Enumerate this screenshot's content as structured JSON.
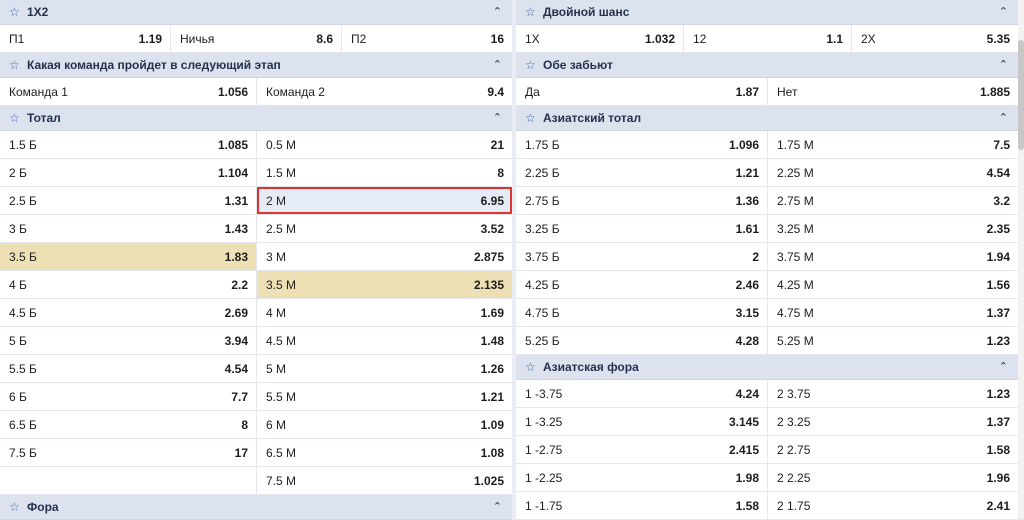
{
  "left": {
    "x12": {
      "title": "1X2",
      "items": [
        {
          "label": "П1",
          "odd": "1.19"
        },
        {
          "label": "Ничья",
          "odd": "8.6"
        },
        {
          "label": "П2",
          "odd": "16"
        }
      ]
    },
    "advance": {
      "title": "Какая команда пройдет в следующий этап",
      "items": [
        {
          "label": "Команда 1",
          "odd": "1.056"
        },
        {
          "label": "Команда 2",
          "odd": "9.4"
        }
      ]
    },
    "total": {
      "title": "Тотал",
      "rows": [
        [
          {
            "label": "1.5 Б",
            "odd": "1.085"
          },
          {
            "label": "0.5 М",
            "odd": "21"
          }
        ],
        [
          {
            "label": "2 Б",
            "odd": "1.104"
          },
          {
            "label": "1.5 М",
            "odd": "8"
          }
        ],
        [
          {
            "label": "2.5 Б",
            "odd": "1.31"
          },
          {
            "label": "2 М",
            "odd": "6.95",
            "selected": true
          }
        ],
        [
          {
            "label": "3 Б",
            "odd": "1.43"
          },
          {
            "label": "2.5 М",
            "odd": "3.52"
          }
        ],
        [
          {
            "label": "3.5 Б",
            "odd": "1.83",
            "highlight": true
          },
          {
            "label": "3 М",
            "odd": "2.875"
          }
        ],
        [
          {
            "label": "4 Б",
            "odd": "2.2"
          },
          {
            "label": "3.5 М",
            "odd": "2.135",
            "highlight": true
          }
        ],
        [
          {
            "label": "4.5 Б",
            "odd": "2.69"
          },
          {
            "label": "4 М",
            "odd": "1.69"
          }
        ],
        [
          {
            "label": "5 Б",
            "odd": "3.94"
          },
          {
            "label": "4.5 М",
            "odd": "1.48"
          }
        ],
        [
          {
            "label": "5.5 Б",
            "odd": "4.54"
          },
          {
            "label": "5 М",
            "odd": "1.26"
          }
        ],
        [
          {
            "label": "6 Б",
            "odd": "7.7"
          },
          {
            "label": "5.5 М",
            "odd": "1.21"
          }
        ],
        [
          {
            "label": "6.5 Б",
            "odd": "8"
          },
          {
            "label": "6 М",
            "odd": "1.09"
          }
        ],
        [
          {
            "label": "7.5 Б",
            "odd": "17"
          },
          {
            "label": "6.5 М",
            "odd": "1.08"
          }
        ],
        [
          {
            "label": "",
            "odd": ""
          },
          {
            "label": "7.5 М",
            "odd": "1.025"
          }
        ]
      ]
    },
    "fora": {
      "title": "Фора"
    }
  },
  "right": {
    "double": {
      "title": "Двойной шанс",
      "items": [
        {
          "label": "1X",
          "odd": "1.032"
        },
        {
          "label": "12",
          "odd": "1.1"
        },
        {
          "label": "2X",
          "odd": "5.35"
        }
      ]
    },
    "btts": {
      "title": "Обе забьют",
      "items": [
        {
          "label": "Да",
          "odd": "1.87"
        },
        {
          "label": "Нет",
          "odd": "1.885"
        }
      ]
    },
    "asianTotal": {
      "title": "Азиатский тотал",
      "rows": [
        [
          {
            "label": "1.75 Б",
            "odd": "1.096"
          },
          {
            "label": "1.75 М",
            "odd": "7.5"
          }
        ],
        [
          {
            "label": "2.25 Б",
            "odd": "1.21"
          },
          {
            "label": "2.25 М",
            "odd": "4.54"
          }
        ],
        [
          {
            "label": "2.75 Б",
            "odd": "1.36"
          },
          {
            "label": "2.75 М",
            "odd": "3.2"
          }
        ],
        [
          {
            "label": "3.25 Б",
            "odd": "1.61"
          },
          {
            "label": "3.25 М",
            "odd": "2.35"
          }
        ],
        [
          {
            "label": "3.75 Б",
            "odd": "2"
          },
          {
            "label": "3.75 М",
            "odd": "1.94"
          }
        ],
        [
          {
            "label": "4.25 Б",
            "odd": "2.46"
          },
          {
            "label": "4.25 М",
            "odd": "1.56"
          }
        ],
        [
          {
            "label": "4.75 Б",
            "odd": "3.15"
          },
          {
            "label": "4.75 М",
            "odd": "1.37"
          }
        ],
        [
          {
            "label": "5.25 Б",
            "odd": "4.28"
          },
          {
            "label": "5.25 М",
            "odd": "1.23"
          }
        ]
      ]
    },
    "asianFora": {
      "title": "Азиатская фора",
      "rows": [
        [
          {
            "label": "1 -3.75",
            "odd": "4.24"
          },
          {
            "label": "2 3.75",
            "odd": "1.23"
          }
        ],
        [
          {
            "label": "1 -3.25",
            "odd": "3.145"
          },
          {
            "label": "2 3.25",
            "odd": "1.37"
          }
        ],
        [
          {
            "label": "1 -2.75",
            "odd": "2.415"
          },
          {
            "label": "2 2.75",
            "odd": "1.58"
          }
        ],
        [
          {
            "label": "1 -2.25",
            "odd": "1.98"
          },
          {
            "label": "2 2.25",
            "odd": "1.96"
          }
        ],
        [
          {
            "label": "1 -1.75",
            "odd": "1.58"
          },
          {
            "label": "2 1.75",
            "odd": "2.41"
          }
        ]
      ]
    }
  }
}
